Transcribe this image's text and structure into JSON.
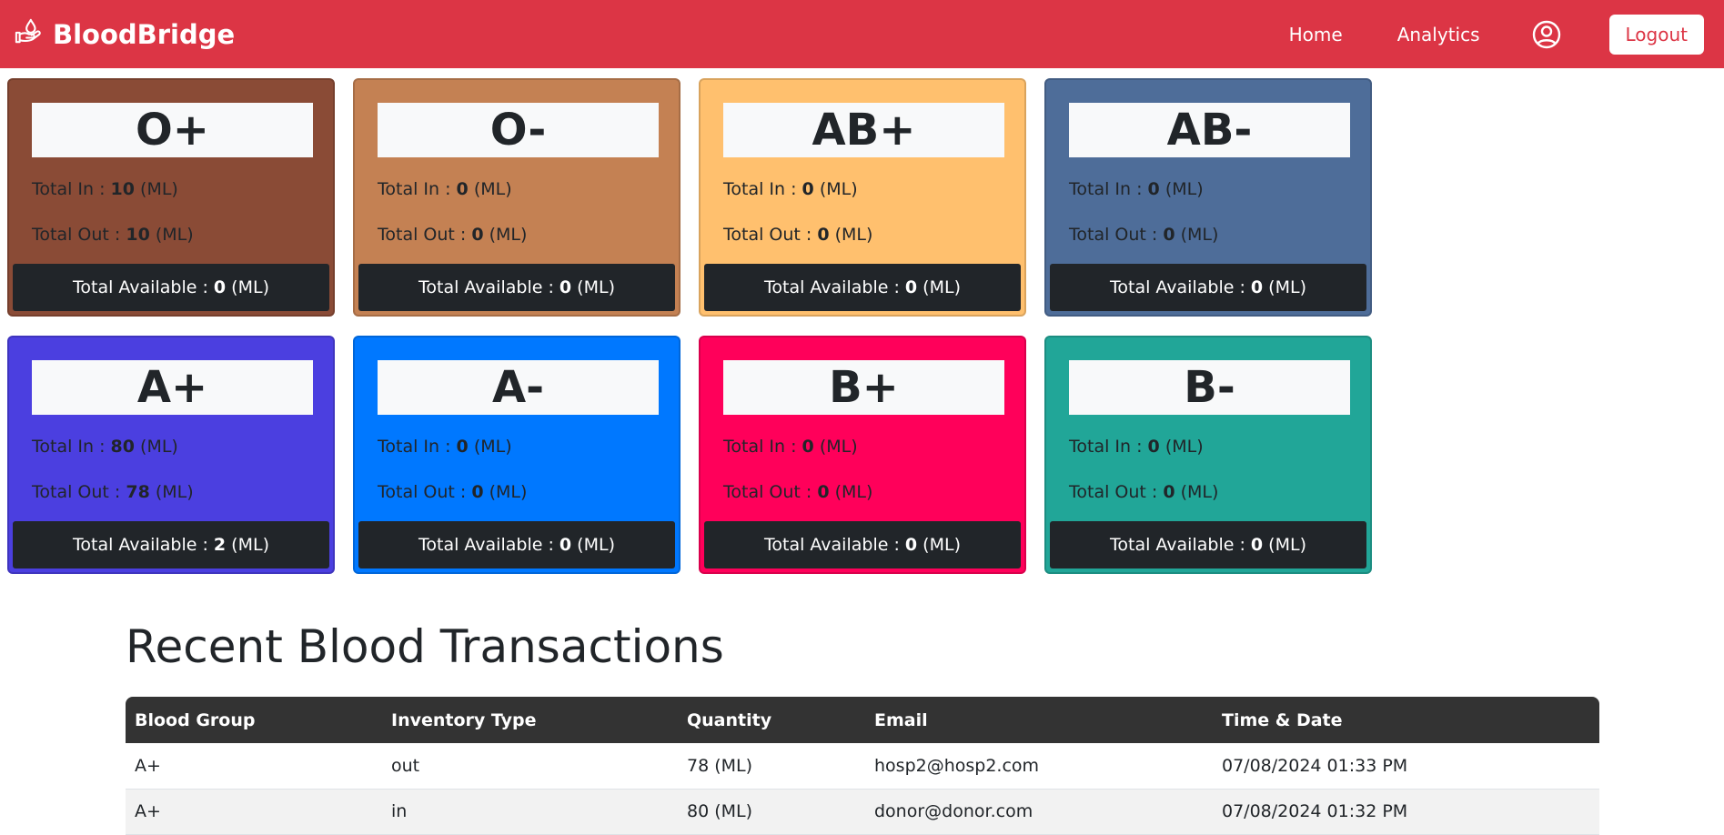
{
  "navbar": {
    "brand": "BloodBridge",
    "home": "Home",
    "analytics": "Analytics",
    "logout": "Logout",
    "bg_color": "#dc3545"
  },
  "labels": {
    "total_in": "Total In : ",
    "total_out": "Total Out : ",
    "total_available": "Total Available : ",
    "unit": " (ML)"
  },
  "cards": [
    {
      "group": "O+",
      "in": "10",
      "out": "10",
      "available": "0",
      "color": "#8a4b36"
    },
    {
      "group": "O-",
      "in": "0",
      "out": "0",
      "available": "0",
      "color": "#c48153"
    },
    {
      "group": "AB+",
      "in": "0",
      "out": "0",
      "available": "0",
      "color": "#ffc06e"
    },
    {
      "group": "AB-",
      "in": "0",
      "out": "0",
      "available": "0",
      "color": "#4e6d99"
    },
    {
      "group": "A+",
      "in": "80",
      "out": "78",
      "available": "2",
      "color": "#4b3fe0"
    },
    {
      "group": "A-",
      "in": "0",
      "out": "0",
      "available": "0",
      "color": "#0078ff"
    },
    {
      "group": "B+",
      "in": "0",
      "out": "0",
      "available": "0",
      "color": "#ff005a"
    },
    {
      "group": "B-",
      "in": "0",
      "out": "0",
      "available": "0",
      "color": "#21a698"
    }
  ],
  "transactions": {
    "title": "Recent Blood Transactions",
    "headers": [
      "Blood Group",
      "Inventory Type",
      "Quantity",
      "Email",
      "Time & Date"
    ],
    "rows": [
      [
        "A+",
        "out",
        "78 (ML)",
        "hosp2@hosp2.com",
        "07/08/2024 01:33 PM"
      ],
      [
        "A+",
        "in",
        "80 (ML)",
        "donor@donor.com",
        "07/08/2024 01:32 PM"
      ]
    ]
  }
}
